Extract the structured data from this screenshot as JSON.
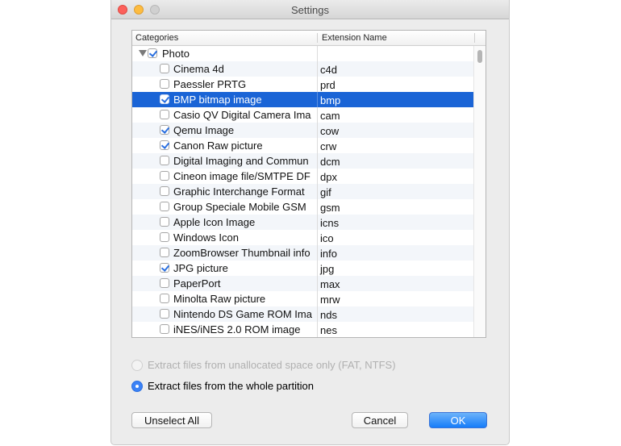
{
  "window": {
    "title": "Settings"
  },
  "table": {
    "headers": {
      "categories": "Categories",
      "extension": "Extension Name"
    },
    "parent": {
      "label": "Photo",
      "checked": true,
      "expanded": true
    },
    "rows": [
      {
        "label": "Cinema 4d",
        "ext": "c4d",
        "checked": false,
        "selected": false
      },
      {
        "label": "Paessler PRTG",
        "ext": "prd",
        "checked": false,
        "selected": false
      },
      {
        "label": "BMP bitmap image",
        "ext": "bmp",
        "checked": true,
        "selected": true
      },
      {
        "label": "Casio QV Digital Camera Ima",
        "ext": "cam",
        "checked": false,
        "selected": false
      },
      {
        "label": "Qemu Image",
        "ext": "cow",
        "checked": true,
        "selected": false
      },
      {
        "label": "Canon Raw picture",
        "ext": "crw",
        "checked": true,
        "selected": false
      },
      {
        "label": "Digital Imaging and Commun",
        "ext": "dcm",
        "checked": false,
        "selected": false
      },
      {
        "label": "Cineon image file/SMTPE DF",
        "ext": "dpx",
        "checked": false,
        "selected": false
      },
      {
        "label": "Graphic Interchange Format",
        "ext": "gif",
        "checked": false,
        "selected": false
      },
      {
        "label": "Group Speciale Mobile GSM",
        "ext": "gsm",
        "checked": false,
        "selected": false
      },
      {
        "label": "Apple Icon Image",
        "ext": "icns",
        "checked": false,
        "selected": false
      },
      {
        "label": "Windows Icon",
        "ext": "ico",
        "checked": false,
        "selected": false
      },
      {
        "label": "ZoomBrowser Thumbnail info",
        "ext": "info",
        "checked": false,
        "selected": false
      },
      {
        "label": "JPG picture",
        "ext": "jpg",
        "checked": true,
        "selected": false
      },
      {
        "label": "PaperPort",
        "ext": "max",
        "checked": false,
        "selected": false
      },
      {
        "label": "Minolta Raw picture",
        "ext": "mrw",
        "checked": false,
        "selected": false
      },
      {
        "label": "Nintendo DS Game ROM Ima",
        "ext": "nds",
        "checked": false,
        "selected": false
      },
      {
        "label": "iNES/iNES 2.0 ROM image",
        "ext": "nes",
        "checked": false,
        "selected": false
      }
    ]
  },
  "options": {
    "unallocated": {
      "label": "Extract files from unallocated space only (FAT, NTFS)",
      "disabled": true,
      "checked": false
    },
    "whole_partition": {
      "label": "Extract files from the whole partition",
      "disabled": false,
      "checked": true
    }
  },
  "buttons": {
    "unselect_all": "Unselect All",
    "cancel": "Cancel",
    "ok": "OK"
  },
  "colors": {
    "selection": "#1a64d6",
    "accent": "#167cf9"
  }
}
